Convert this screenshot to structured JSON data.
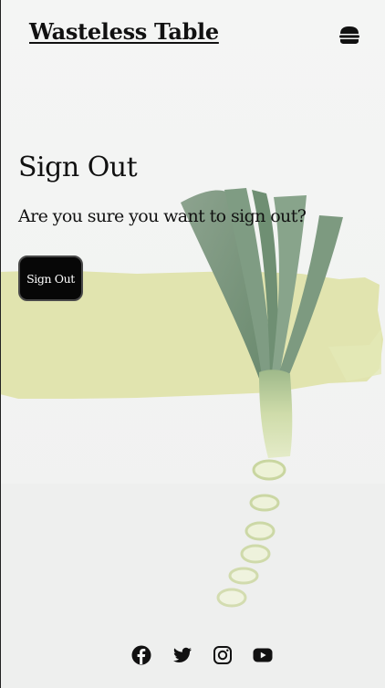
{
  "header": {
    "brand": "Wasteless Table",
    "menu_icon": "hamburger-icon"
  },
  "main": {
    "title": "Sign Out",
    "question": "Are you sure you want to sign out?",
    "signout_button": "Sign Out"
  },
  "footer": {
    "icons": [
      "facebook-icon",
      "twitter-icon",
      "instagram-icon",
      "youtube-icon"
    ]
  },
  "colors": {
    "background": "#f3f4f3",
    "brush_stroke": "#dfe3a9",
    "button": "#070707",
    "text": "#111111"
  }
}
